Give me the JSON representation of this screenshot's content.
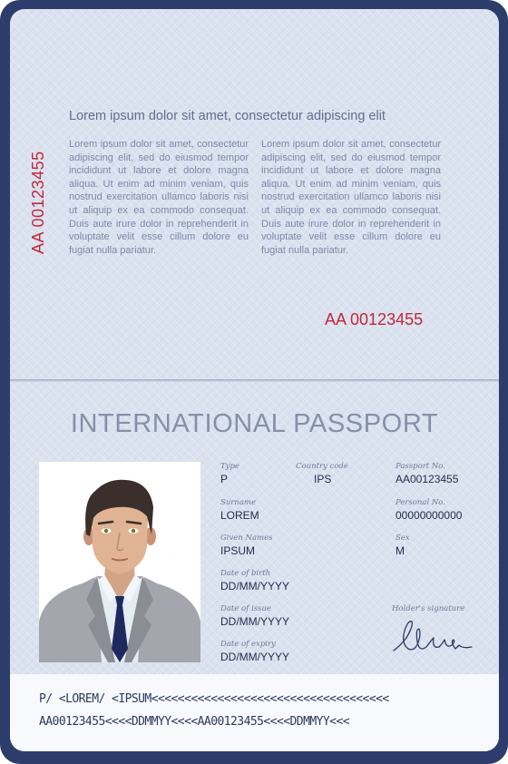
{
  "top_page": {
    "serial_vertical": "AA 00123455",
    "title": "Lorem ipsum dolor sit amet, consectetur adipiscing elit",
    "column_1": "Lorem ipsum dolor sit amet, consectetur adipiscing elit, sed do eiusmod tempor incididunt ut labore et dolore magna aliqua. Ut enim ad minim veniam, quis nostrud exercitation ullamco laboris nisi ut aliquip ex ea commodo consequat. Duis aute irure dolor in reprehenderit in voluptate velit esse cillum dolore eu fugiat nulla pariatur.",
    "column_2": "Lorem ipsum dolor sit amet, consectetur adipiscing elit, sed do eiusmod tempor incididunt ut labore et dolore magna aliqua. Ut enim ad minim veniam, quis nostrud exercitation ullamco laboris nisi ut aliquip ex ea commodo consequat. Duis aute irure dolor in reprehenderit in voluptate velit esse cillum dolore eu fugiat nulla pariatur.",
    "serial_bottom": "AA 00123455"
  },
  "data_page": {
    "title": "INTERNATIONAL PASSPORT",
    "type": {
      "label": "Type",
      "value": "P"
    },
    "country_code": {
      "label": "Country code",
      "value": "IPS"
    },
    "passport_no": {
      "label": "Passport No.",
      "value": "AA00123455"
    },
    "surname": {
      "label": "Surname",
      "value": "LOREM"
    },
    "personal_no": {
      "label": "Personal No.",
      "value": "00000000000"
    },
    "given_names": {
      "label": "Given Names",
      "value": "IPSUM"
    },
    "sex": {
      "label": "Sex",
      "value": "M"
    },
    "date_of_birth": {
      "label": "Date of birth",
      "value": "DD/MM/YYYY"
    },
    "date_of_issue": {
      "label": "Date of issue",
      "value": "DD/MM/YYYY"
    },
    "date_of_expiry": {
      "label": "Date of expiry",
      "value": "DD/MM/YYYY"
    },
    "signature": {
      "label": "Holder's signature"
    },
    "mrz_line_1": "P/ <LOREM/ <IPSUM<<<<<<<<<<<<<<<<<<<<<<<<<<<<<<<<<<<<",
    "mrz_line_2": "AA00123455<<<<DDMMYY<<<<AA00123455<<<<DDMMYY<<<"
  },
  "colors": {
    "cover": "#2d3d6b",
    "page": "#dbe2ef",
    "serial_red": "#c2273b",
    "title_gray": "#8590a8"
  },
  "icons": [
    "holder-photo-icon",
    "signature-icon"
  ]
}
